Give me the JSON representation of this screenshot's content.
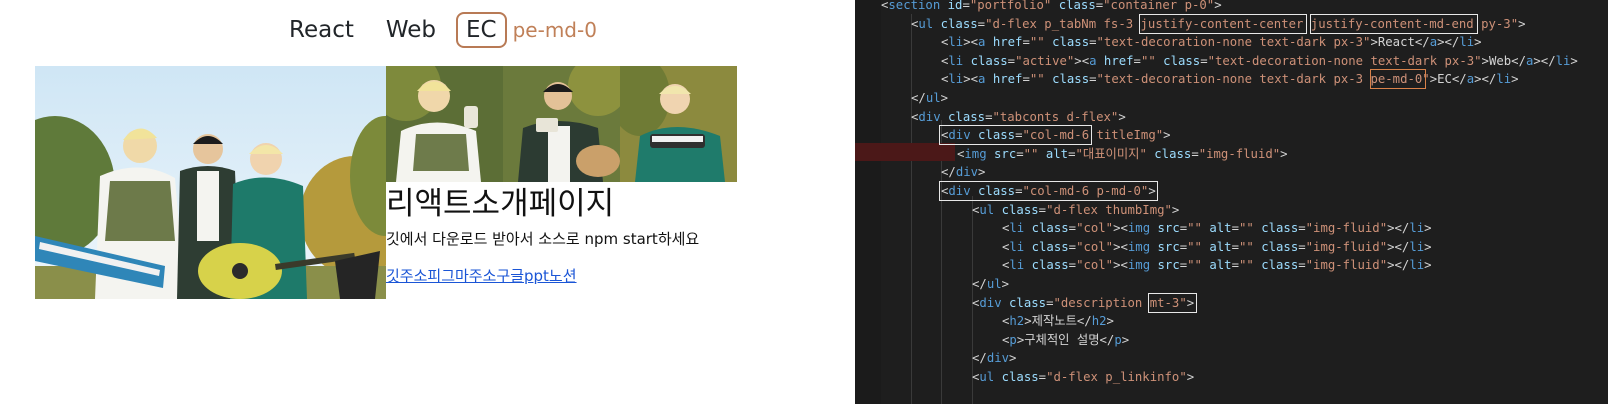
{
  "preview": {
    "tabs": [
      {
        "label": "React"
      },
      {
        "label": "Web"
      },
      {
        "label": "EC"
      }
    ],
    "pe_label": "pe-md-0",
    "hero_alt": "대표이미지",
    "description": {
      "title": "리액트소개페이지",
      "text": "깃에서 다운로드 받아서 소스로 npm start하세요",
      "links_text": "깃주소피그마주소구글ppt노션"
    }
  },
  "editor": {
    "lines": [
      "<section id=\"portfolio\" class=\"container p-0\">",
      "<ul class=\"d-flex p_tabNm fs-3 justify-content-center justify-content-md-end py-3\">",
      "<li><a href=\"\" class=\"text-decoration-none text-dark px-3\">React</a></li>",
      "<li class=\"active\"><a href=\"\" class=\"text-decoration-none text-dark px-3\">Web</a></li>",
      "<li><a href=\"\" class=\"text-decoration-none text-dark px-3 pe-md-0\">EC</a></li>",
      "</ul>",
      "<div class=\"tabconts d-flex\">",
      "<div class=\"col-md-6 titleImg\">",
      "<img src=\"\" alt=\"대표이미지\" class=\"img-fluid\">",
      "</div>",
      "<div class=\"col-md-6 p-md-0\">",
      "<ul class=\"d-flex thumbImg\">",
      "<li class=\"col\"><img src=\"\" alt=\"\" class=\"img-fluid\"></li>",
      "<li class=\"col\"><img src=\"\" alt=\"\" class=\"img-fluid\"></li>",
      "<li class=\"col\"><img src=\"\" alt=\"\" class=\"img-fluid\"></li>",
      "</ul>",
      "<div class=\"description mt-3\">",
      "<h2>제작노트</h2>",
      "<p>구체적인 설명</p>",
      "</div>",
      "<ul class=\"d-flex p_linkinfo\">"
    ]
  }
}
